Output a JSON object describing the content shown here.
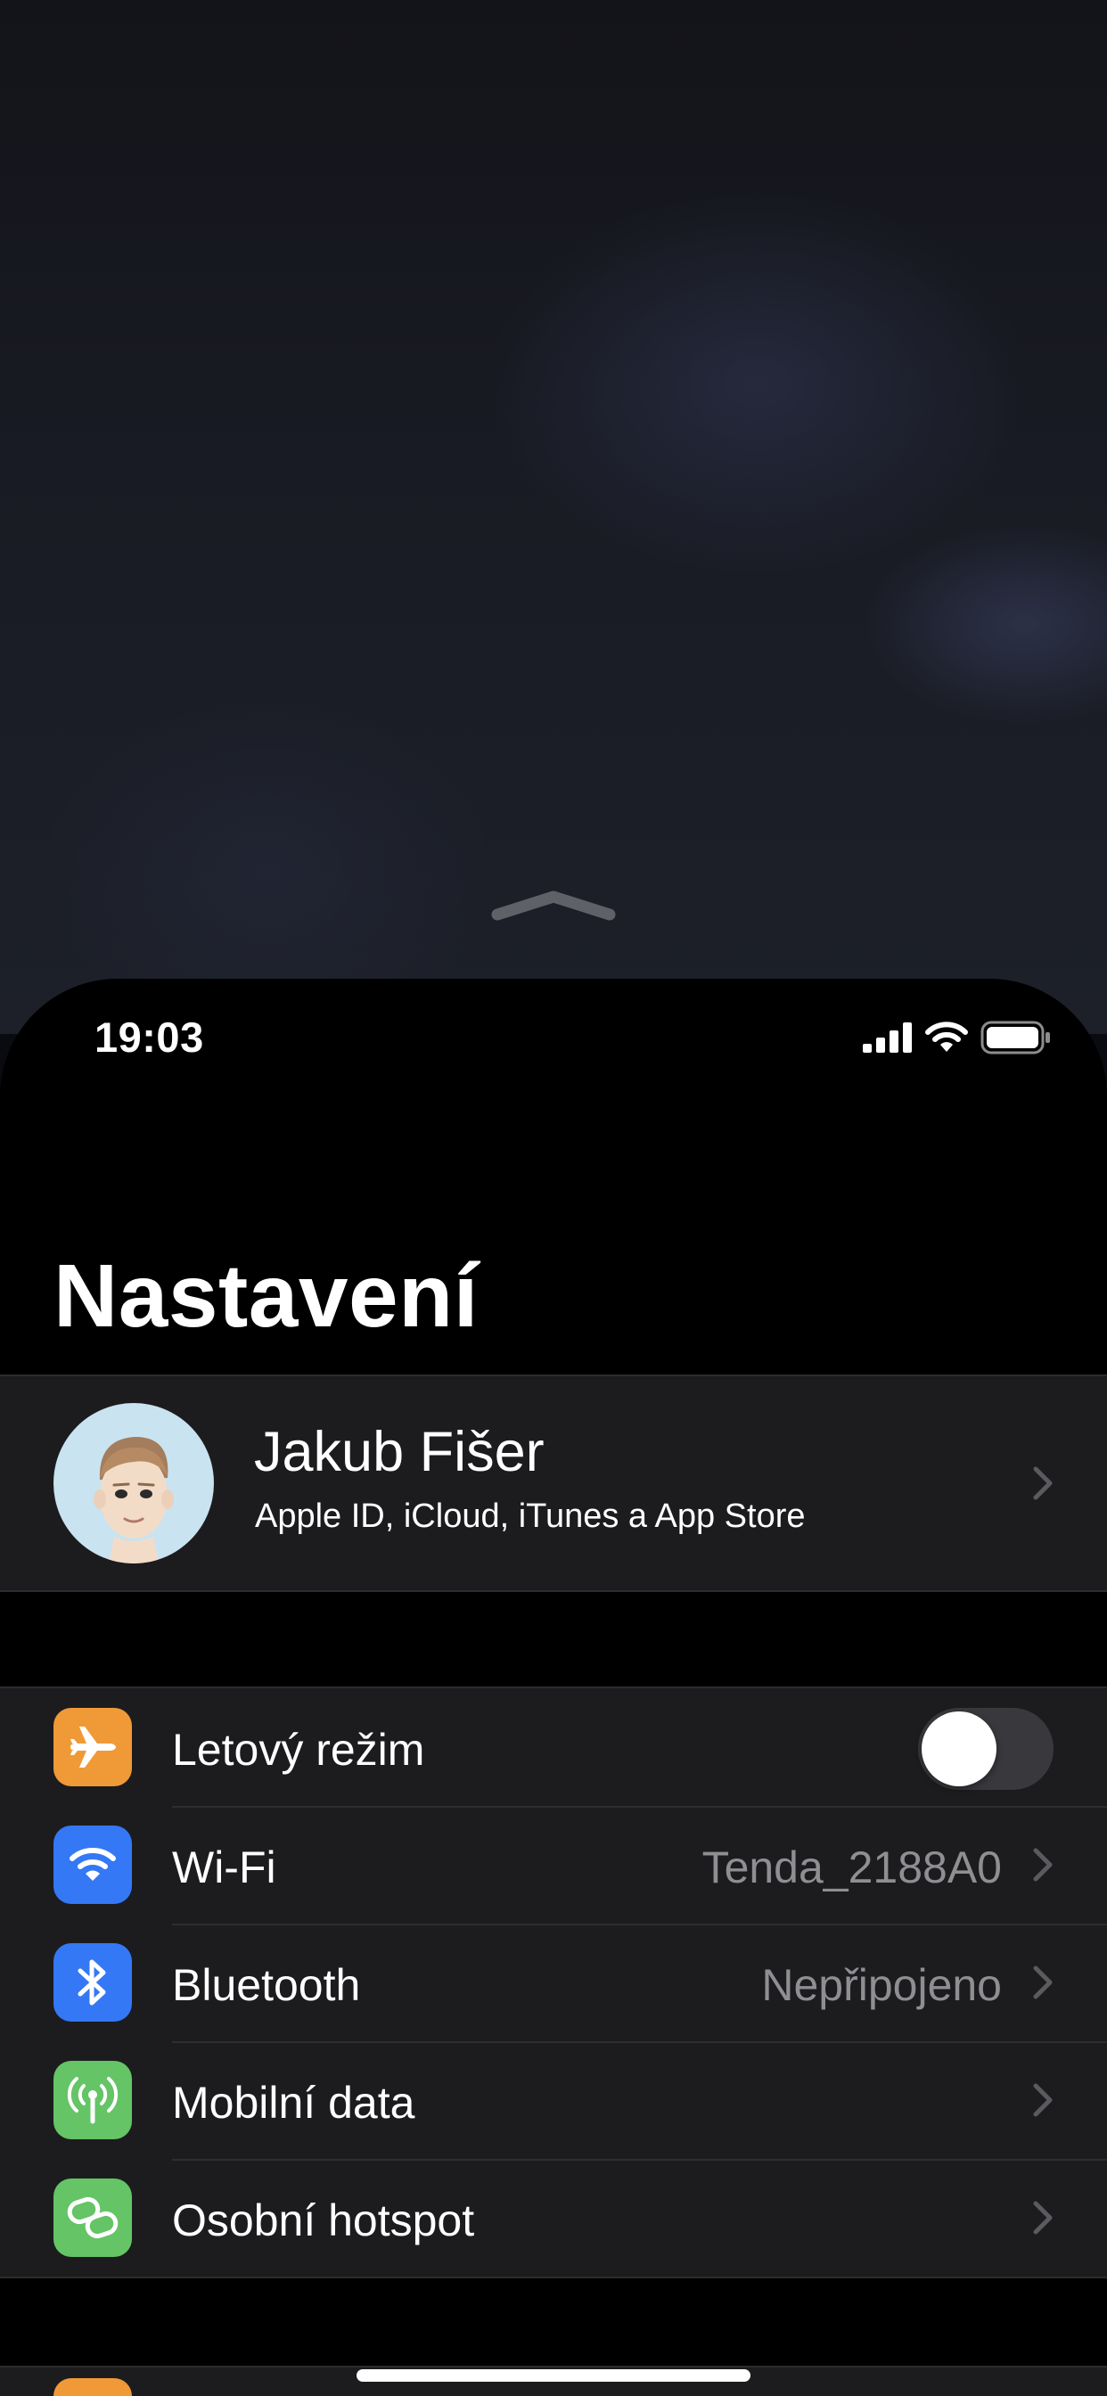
{
  "status_bar": {
    "time": "19:03",
    "icons": [
      "cellular-signal-icon",
      "wifi-icon",
      "battery-icon"
    ]
  },
  "page": {
    "title": "Nastavení"
  },
  "profile": {
    "name": "Jakub Fišer",
    "subtitle": "Apple ID, iCloud, iTunes a App Store",
    "avatar": "memoji-avatar"
  },
  "connectivity": [
    {
      "label": "Letový režim",
      "icon": "airplane-icon",
      "icon_bg": "#f09a37",
      "control": "toggle",
      "enabled": false
    },
    {
      "label": "Wi-Fi",
      "value": "Tenda_2188A0",
      "icon": "wifi-icon",
      "icon_bg": "#3478f6",
      "control": "chevron"
    },
    {
      "label": "Bluetooth",
      "value": "Nepřipojeno",
      "icon": "bluetooth-icon",
      "icon_bg": "#3478f6",
      "control": "chevron"
    },
    {
      "label": "Mobilní data",
      "value": "",
      "icon": "antenna-icon",
      "icon_bg": "#65c466",
      "control": "chevron"
    },
    {
      "label": "Osobní hotspot",
      "value": "",
      "icon": "hotspot-icon",
      "icon_bg": "#65c466",
      "control": "chevron"
    }
  ],
  "colors": {
    "background": "#000000",
    "cell": "#1c1c1e",
    "secondary_text": "#8e8e93",
    "orange": "#f09a37",
    "blue": "#3478f6",
    "green": "#65c466"
  }
}
